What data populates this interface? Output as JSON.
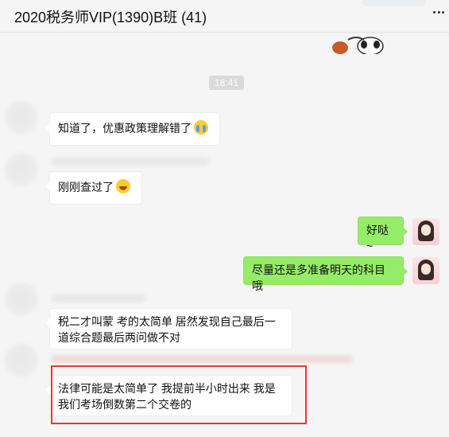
{
  "header": {
    "title": "2020税务师VIP(1390)B班 (41)"
  },
  "timestamp": "18:41",
  "messages": [
    {
      "side": "left",
      "text": "知道了，优惠政策理解错了",
      "emoji": "crying-emoji"
    },
    {
      "side": "left",
      "text": "刚刚查过了",
      "emoji": "laughing-emoji"
    },
    {
      "side": "right",
      "text": "好哒~"
    },
    {
      "side": "right",
      "text": "尽量还是多准备明天的科目哦"
    },
    {
      "side": "left",
      "text": "税二才叫蒙 考的太简单 居然发现自己最后一道综合题最后两问做不对"
    },
    {
      "side": "left",
      "text": "法律可能是太简单了 我提前半小时出来 我是我们考场倒数第二个交卷的"
    }
  ],
  "colors": {
    "my_bubble": "#95ec69",
    "their_bubble": "#ffffff",
    "highlight": "#e53935"
  },
  "icons": {
    "more": "more-icon",
    "sticker": "cow-sticker"
  }
}
